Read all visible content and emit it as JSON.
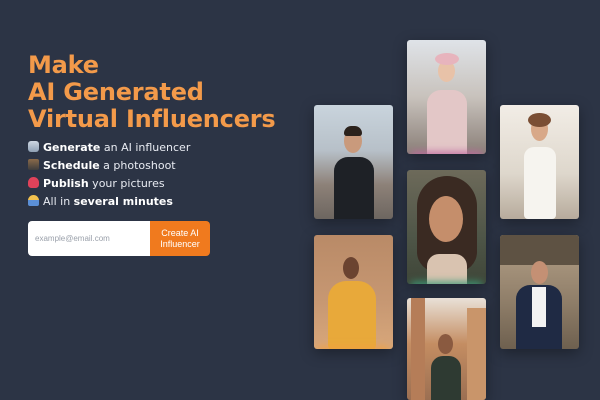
{
  "hero": {
    "title_lines": [
      "Make",
      "AI Generated",
      "Virtual Influencers"
    ]
  },
  "features": [
    {
      "icon": "robot-icon",
      "bold": "Generate",
      "text": " an AI influencer"
    },
    {
      "icon": "camera-icon",
      "bold": "Schedule",
      "text": " a photoshoot"
    },
    {
      "icon": "heart-icon",
      "bold": "Publish",
      "text": " your pictures"
    },
    {
      "icon": "person-icon",
      "pre": "All in ",
      "bold": "several minutes"
    }
  ],
  "signup": {
    "placeholder": "example@email.com",
    "button_label": "Create AI Influencer"
  },
  "colors": {
    "background": "#2c3445",
    "accent": "#f39a4a",
    "button": "#f07a1e"
  },
  "gallery": [
    {
      "name": "photo-man-black-coat"
    },
    {
      "name": "photo-woman-yellow-dress"
    },
    {
      "name": "photo-woman-pink-beret"
    },
    {
      "name": "photo-woman-portrait"
    },
    {
      "name": "photo-woman-street"
    },
    {
      "name": "photo-woman-white-dress"
    },
    {
      "name": "photo-man-navy-blazer"
    }
  ]
}
